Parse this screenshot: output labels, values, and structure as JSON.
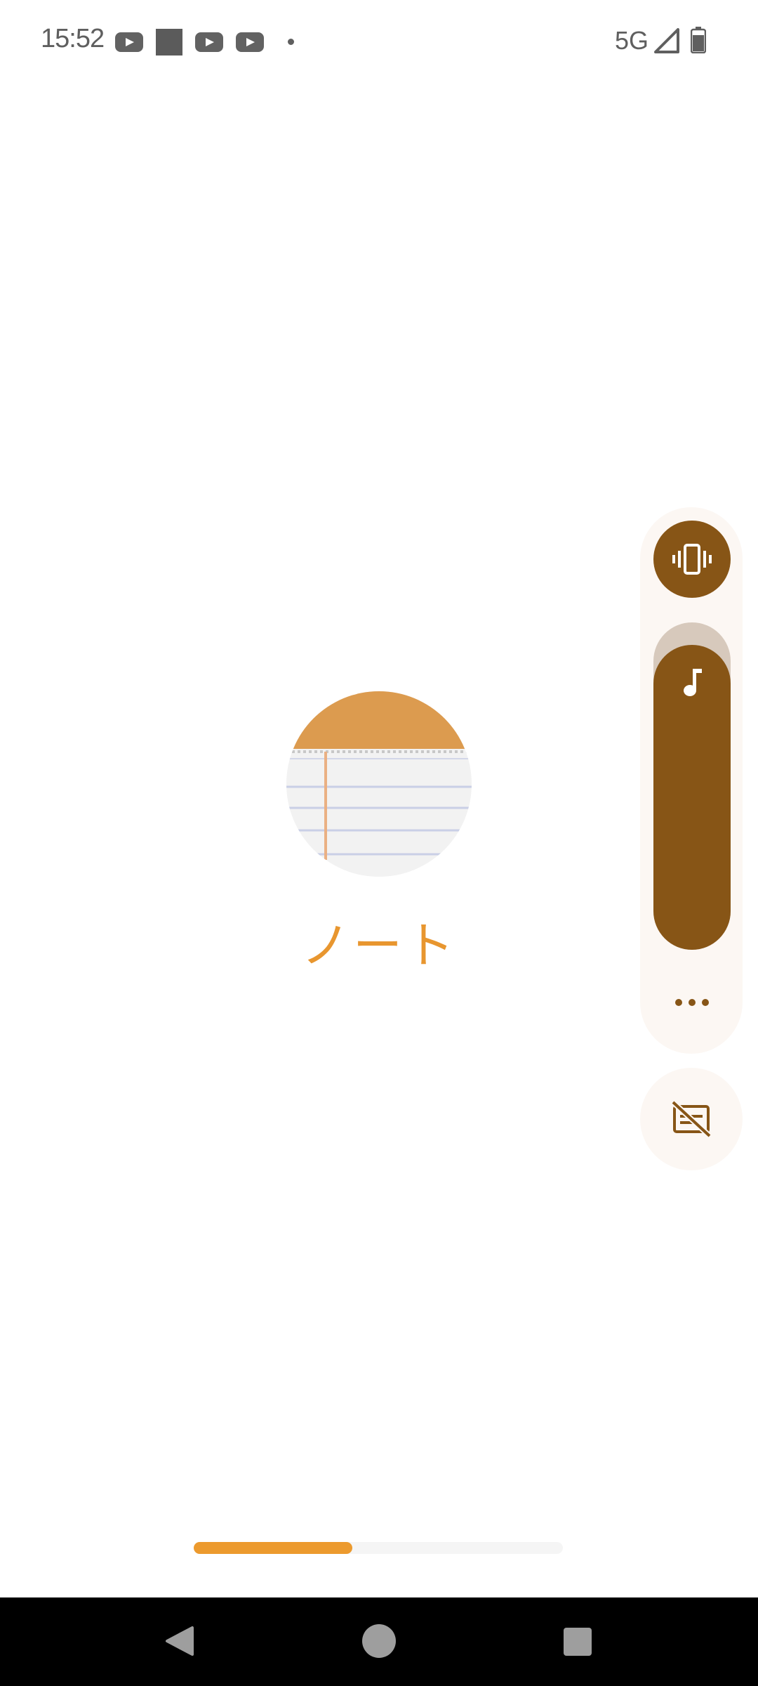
{
  "status_bar": {
    "time": "15:52",
    "network": "5G",
    "icons": [
      "youtube-icon",
      "square-notification-icon",
      "youtube-icon",
      "youtube-icon",
      "more-notifications-dot",
      "signal-icon",
      "battery-icon"
    ]
  },
  "app": {
    "name": "ノート",
    "icon": "notepad-icon",
    "accent_color": "#e8962f"
  },
  "volume_panel": {
    "ringer_mode_icon": "vibrate-icon",
    "stream_icon": "music-note-icon",
    "more_icon": "more-horiz-icon",
    "captions_icon": "captions-off-icon",
    "level": 0.93,
    "accent_color": "#875516"
  },
  "loading": {
    "progress": 0.43,
    "color": "#ec9a2e"
  },
  "nav_bar": {
    "buttons": [
      "back",
      "home",
      "recents"
    ]
  }
}
